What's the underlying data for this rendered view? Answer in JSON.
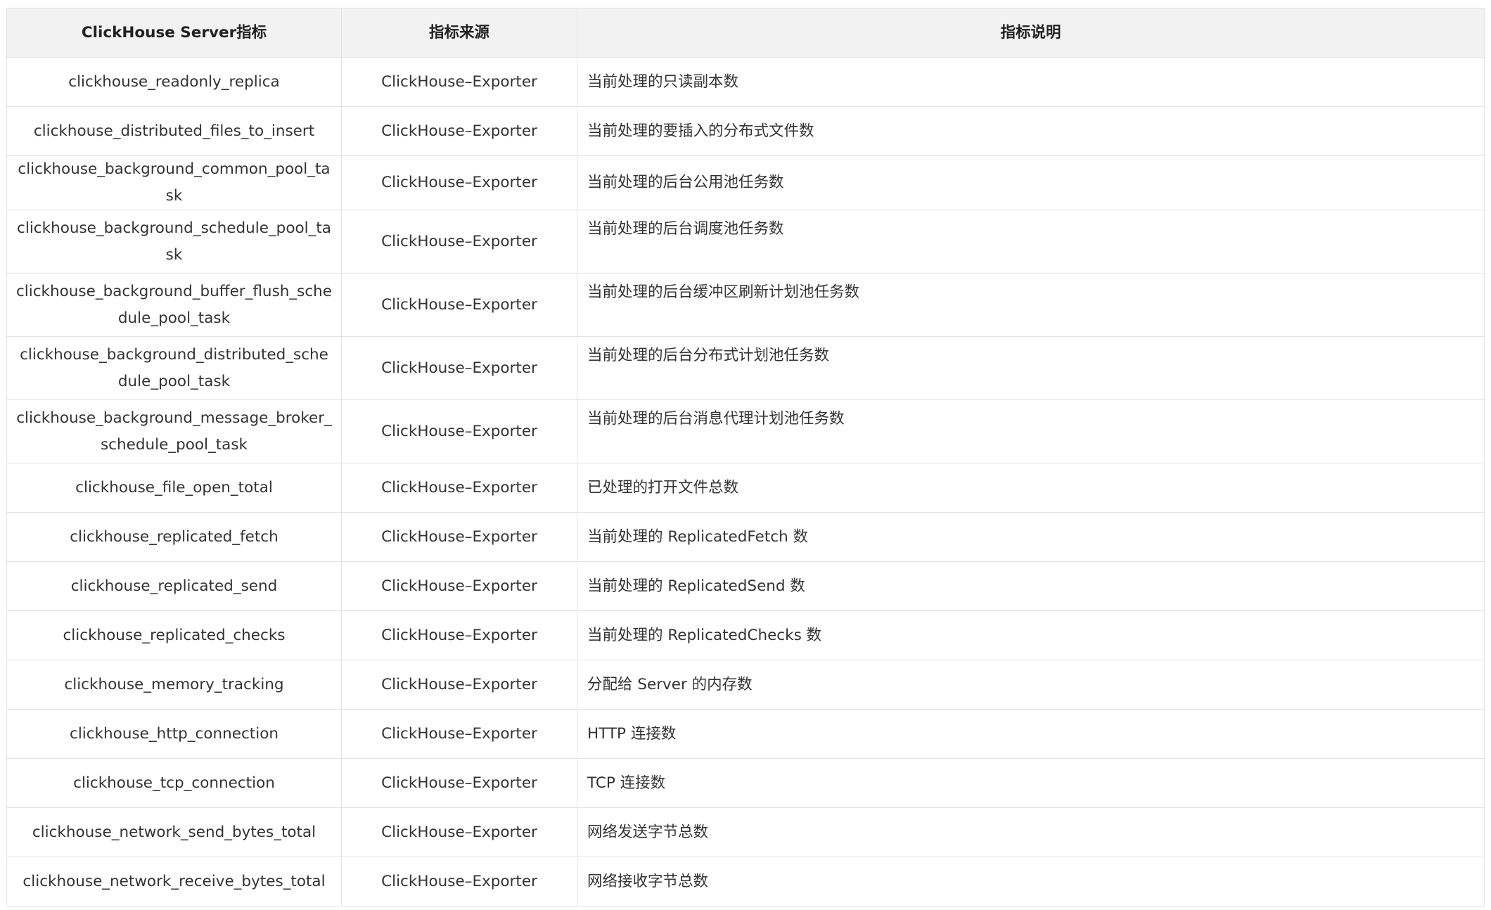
{
  "table": {
    "headers": [
      "ClickHouse Server指标",
      "指标来源",
      "指标说明"
    ],
    "rows": [
      {
        "metric": "clickhouse_readonly_replica",
        "source": "ClickHouse–Exporter",
        "desc": "当前处理的只读副本数",
        "tall": false
      },
      {
        "metric": "clickhouse_distributed_files_to_insert",
        "source": "ClickHouse–Exporter",
        "desc": "当前处理的要插入的分布式文件数",
        "tall": false
      },
      {
        "metric": "clickhouse_background_common_pool_task",
        "source": "ClickHouse–Exporter",
        "desc": "当前处理的后台公用池任务数",
        "tall": false
      },
      {
        "metric": "clickhouse_background_schedule_pool_task",
        "source": "ClickHouse–Exporter",
        "desc": "当前处理的后台调度池任务数",
        "tall": true
      },
      {
        "metric": "clickhouse_background_buffer_flush_schedule_pool_task",
        "source": "ClickHouse–Exporter",
        "desc": "当前处理的后台缓冲区刷新计划池任务数",
        "tall": true
      },
      {
        "metric": "clickhouse_background_distributed_schedule_pool_task",
        "source": "ClickHouse–Exporter",
        "desc": "当前处理的后台分布式计划池任务数",
        "tall": true
      },
      {
        "metric": "clickhouse_background_message_broker_schedule_pool_task",
        "source": "ClickHouse–Exporter",
        "desc": "当前处理的后台消息代理计划池任务数",
        "tall": true
      },
      {
        "metric": "clickhouse_file_open_total",
        "source": "ClickHouse–Exporter",
        "desc": "已处理的打开文件总数",
        "tall": false
      },
      {
        "metric": "clickhouse_replicated_fetch",
        "source": "ClickHouse–Exporter",
        "desc": "当前处理的 ReplicatedFetch 数",
        "tall": false
      },
      {
        "metric": "clickhouse_replicated_send",
        "source": "ClickHouse–Exporter",
        "desc": "当前处理的 ReplicatedSend 数",
        "tall": false
      },
      {
        "metric": "clickhouse_replicated_checks",
        "source": "ClickHouse–Exporter",
        "desc": "当前处理的 ReplicatedChecks 数",
        "tall": false
      },
      {
        "metric": "clickhouse_memory_tracking",
        "source": "ClickHouse–Exporter",
        "desc": "分配给 Server 的内存数",
        "tall": false
      },
      {
        "metric": "clickhouse_http_connection",
        "source": "ClickHouse–Exporter",
        "desc": "HTTP 连接数",
        "tall": false
      },
      {
        "metric": "clickhouse_tcp_connection",
        "source": "ClickHouse–Exporter",
        "desc": "TCP 连接数",
        "tall": false
      },
      {
        "metric": "clickhouse_network_send_bytes_total",
        "source": "ClickHouse–Exporter",
        "desc": "网络发送字节总数",
        "tall": false
      },
      {
        "metric": "clickhouse_network_receive_bytes_total",
        "source": "ClickHouse–Exporter",
        "desc": "网络接收字节总数",
        "tall": false
      }
    ]
  }
}
